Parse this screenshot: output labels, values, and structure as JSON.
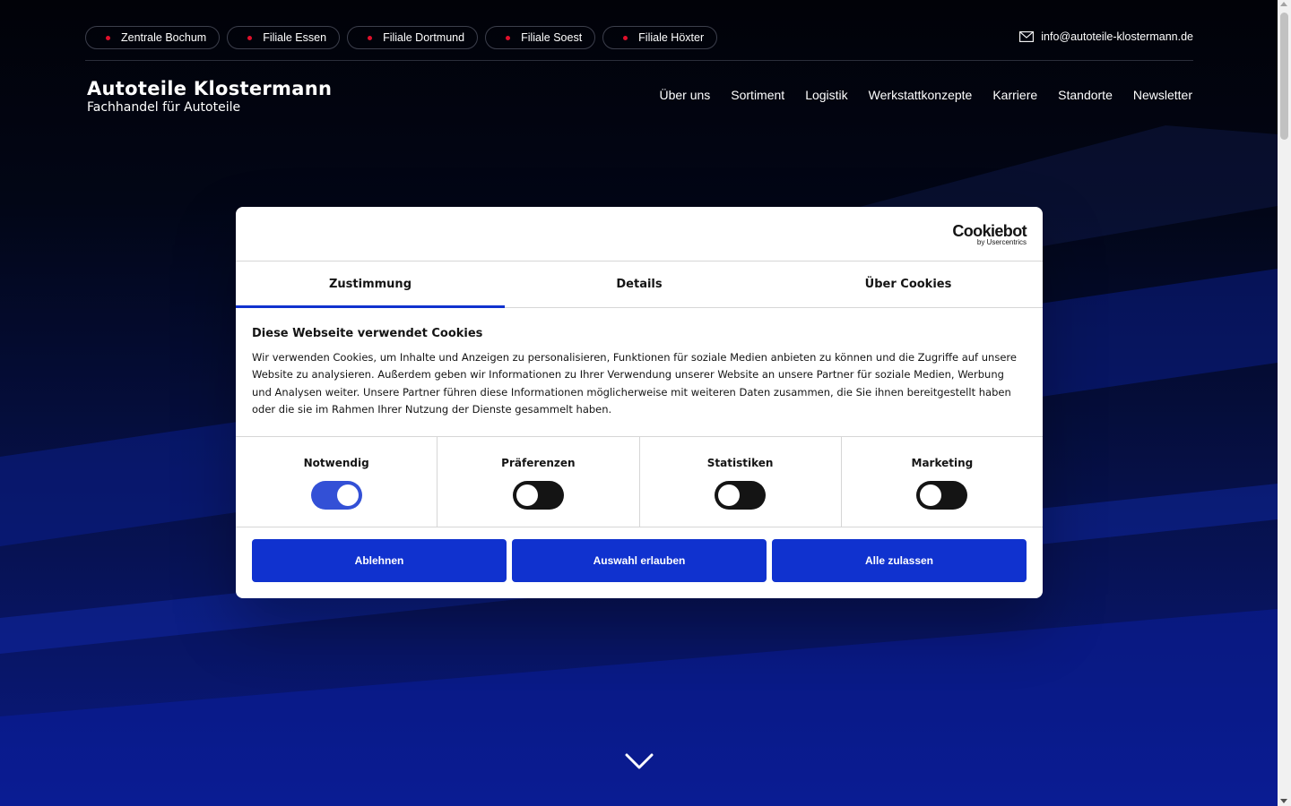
{
  "topbar": {
    "branches": [
      {
        "label": "Zentrale Bochum"
      },
      {
        "label": "Filiale Essen"
      },
      {
        "label": "Filiale Dortmund"
      },
      {
        "label": "Filiale Soest"
      },
      {
        "label": "Filiale Höxter"
      }
    ],
    "email": "info@autoteile-klostermann.de",
    "dot_color": "#e0102b"
  },
  "header": {
    "logo_title": "Autoteile Klostermann",
    "logo_subtitle": "Fachhandel für Autoteile",
    "nav": [
      "Über uns",
      "Sortiment",
      "Logistik",
      "Werkstattkonzepte",
      "Karriere",
      "Standorte",
      "Newsletter"
    ]
  },
  "cookie_dialog": {
    "brand": "Cookiebot",
    "brand_sub": "by Usercentrics",
    "tabs": [
      "Zustimmung",
      "Details",
      "Über Cookies"
    ],
    "active_tab": "Zustimmung",
    "heading": "Diese Webseite verwendet Cookies",
    "text": "Wir verwenden Cookies, um Inhalte und Anzeigen zu personalisieren, Funktionen für soziale Medien anbieten zu können und die Zugriffe auf unsere Website zu analysieren. Außerdem geben wir Informationen zu Ihrer Verwendung unserer Website an unsere Partner für soziale Medien, Werbung und Analysen weiter. Unsere Partner führen diese Informationen möglicherweise mit weiteren Daten zusammen, die Sie ihnen bereitgestellt haben oder die sie im Rahmen Ihrer Nutzung der Dienste gesammelt haben.",
    "categories": [
      {
        "label": "Notwendig",
        "enabled": true
      },
      {
        "label": "Präferenzen",
        "enabled": false
      },
      {
        "label": "Statistiken",
        "enabled": false
      },
      {
        "label": "Marketing",
        "enabled": false
      }
    ],
    "buttons": [
      "Ablehnen",
      "Auswahl erlauben",
      "Alle zulassen"
    ],
    "accent_color": "#1032cf"
  },
  "icons": {
    "mail": "mail-icon",
    "scroll_down": "chevron-down-icon"
  }
}
